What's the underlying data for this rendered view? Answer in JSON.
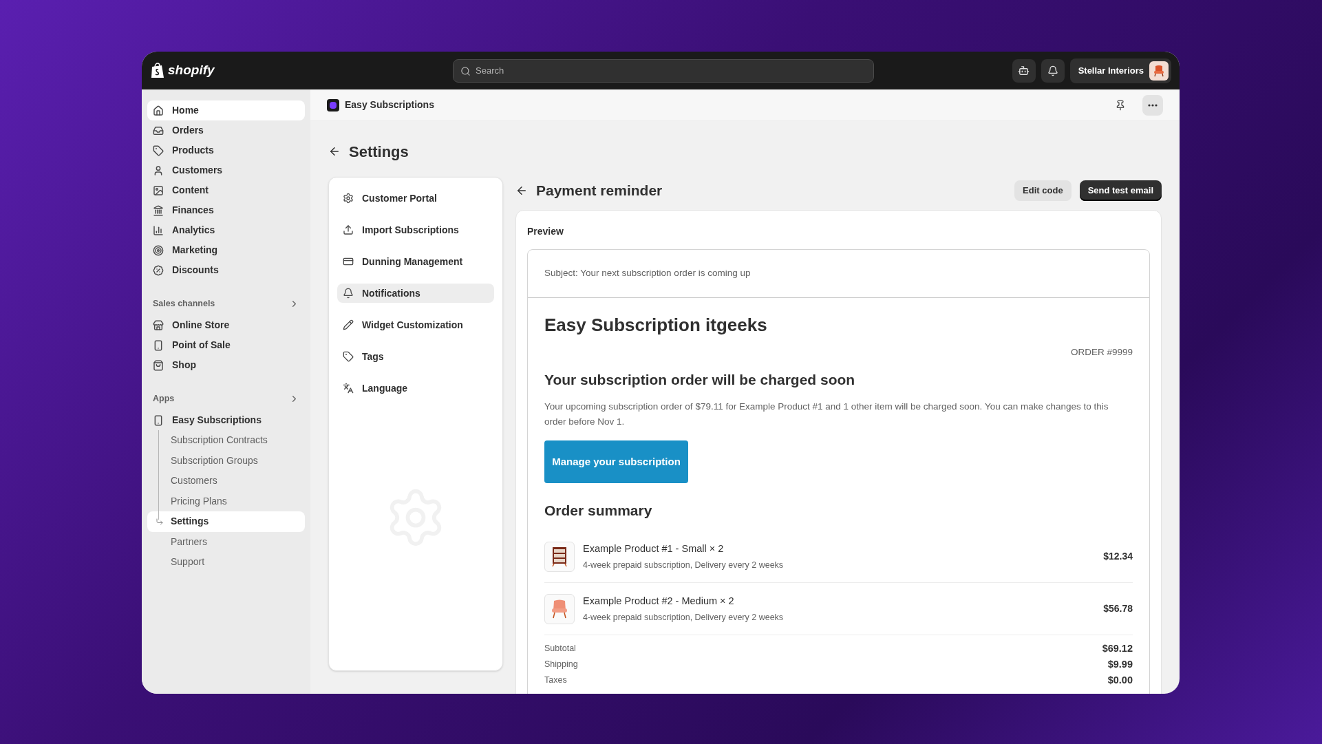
{
  "topbar": {
    "logo": "shopify",
    "search": {
      "placeholder": "Search"
    },
    "store": "Stellar Interiors"
  },
  "sidebar": {
    "items": [
      {
        "label": "Home",
        "selected": true
      },
      {
        "label": "Orders",
        "selected": false
      },
      {
        "label": "Products",
        "selected": false
      },
      {
        "label": "Customers",
        "selected": false
      },
      {
        "label": "Content",
        "selected": false
      },
      {
        "label": "Finances",
        "selected": false
      },
      {
        "label": "Analytics",
        "selected": false
      },
      {
        "label": "Marketing",
        "selected": false
      },
      {
        "label": "Discounts",
        "selected": false
      }
    ],
    "sections": [
      {
        "title": "Sales channels",
        "items": [
          {
            "label": "Online Store",
            "selected": false
          },
          {
            "label": "Point of Sale",
            "selected": false
          },
          {
            "label": "Shop",
            "selected": false
          }
        ]
      },
      {
        "title": "Apps",
        "items": [
          {
            "label": "Easy Subscriptions",
            "selected": false,
            "children": [
              {
                "label": "Subscription Contracts",
                "selected": false
              },
              {
                "label": "Subscription Groups",
                "selected": false
              },
              {
                "label": "Customers",
                "selected": false
              },
              {
                "label": "Pricing Plans",
                "selected": false
              },
              {
                "label": "Settings",
                "selected": true
              },
              {
                "label": "Partners",
                "selected": false
              },
              {
                "label": "Support",
                "selected": false
              }
            ]
          }
        ]
      }
    ]
  },
  "app_header": {
    "title": "Easy Subscriptions"
  },
  "page": {
    "title": "Settings"
  },
  "settings_nav": [
    {
      "label": "Customer Portal",
      "selected": false
    },
    {
      "label": "Import Subscriptions",
      "selected": false
    },
    {
      "label": "Dunning Management",
      "selected": false
    },
    {
      "label": "Notifications",
      "selected": true
    },
    {
      "label": "Widget Customization",
      "selected": false
    },
    {
      "label": "Tags",
      "selected": false
    },
    {
      "label": "Language",
      "selected": false
    }
  ],
  "detail": {
    "title": "Payment reminder",
    "buttons": [
      {
        "label": "Edit code",
        "kind": "secondary"
      },
      {
        "label": "Send test email",
        "kind": "primary"
      }
    ]
  },
  "preview": {
    "label": "Preview",
    "subject": "Subject: Your next subscription order is coming up",
    "store_name": "Easy Subscription itgeeks",
    "order_number": "ORDER #9999",
    "heading": "Your subscription order will be charged soon",
    "body": "Your upcoming subscription order of $79.11 for Example Product #1 and 1 other item will be charged soon. You can make changes to this order before Nov 1.",
    "button": "Manage your subscription",
    "summary_title": "Order summary",
    "line_items": [
      {
        "name": "Example Product #1 - Small × 2",
        "details": "4-week prepaid subscription, Delivery every 2 weeks",
        "price": "$12.34",
        "kind": "shelf"
      },
      {
        "name": "Example Product #2 - Medium × 2",
        "details": "4-week prepaid subscription, Delivery every 2 weeks",
        "price": "$56.78",
        "kind": "chair"
      }
    ],
    "totals": [
      {
        "label": "Subtotal",
        "value": "$69.12"
      },
      {
        "label": "Shipping",
        "value": "$9.99"
      },
      {
        "label": "Taxes",
        "value": "$0.00"
      }
    ]
  }
}
